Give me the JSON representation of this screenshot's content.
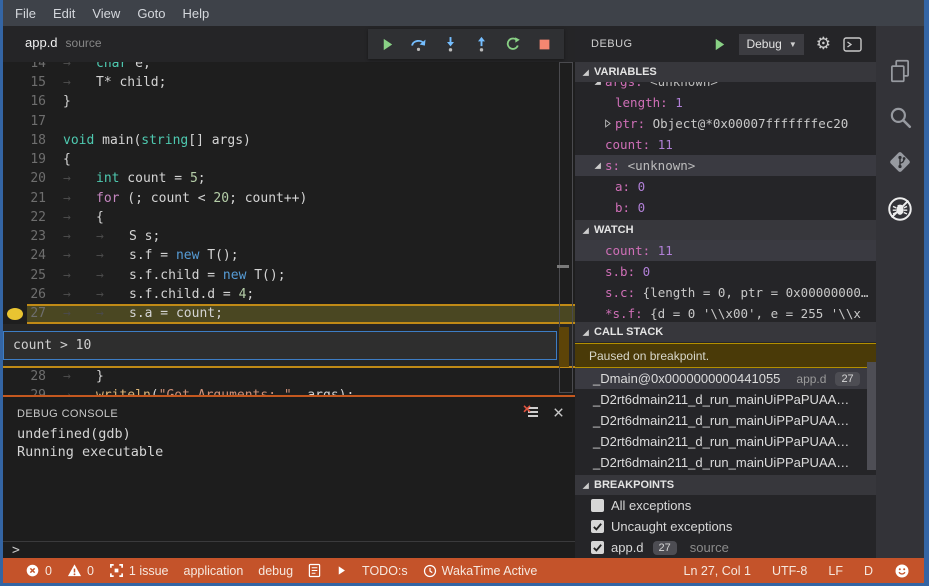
{
  "menu": {
    "items": [
      "File",
      "Edit",
      "View",
      "Goto",
      "Help"
    ]
  },
  "tab": {
    "name": "app.d",
    "hint": "source"
  },
  "toolbar": {
    "buttons": [
      {
        "icon": "continue"
      },
      {
        "icon": "step-over"
      },
      {
        "icon": "step-into"
      },
      {
        "icon": "step-out"
      },
      {
        "icon": "restart"
      },
      {
        "icon": "stop"
      }
    ]
  },
  "editor": {
    "breakpoint_line": 27,
    "current_line": 27,
    "condition": "count > 10",
    "lines": [
      {
        "num": 14,
        "tokens": [
          {
            "c": "tab",
            "v": "→"
          },
          {
            "c": "type",
            "v": "char"
          },
          {
            "v": " e;"
          }
        ]
      },
      {
        "num": 15,
        "tokens": [
          {
            "c": "tab",
            "v": "→"
          },
          {
            "v": "T* child;"
          }
        ]
      },
      {
        "num": 16,
        "tokens": [
          {
            "v": "}"
          }
        ]
      },
      {
        "num": 17,
        "tokens": []
      },
      {
        "num": 18,
        "tokens": [
          {
            "c": "type",
            "v": "void"
          },
          {
            "v": " main("
          },
          {
            "c": "type",
            "v": "string"
          },
          {
            "v": "[] args)"
          }
        ]
      },
      {
        "num": 19,
        "tokens": [
          {
            "v": "{"
          }
        ]
      },
      {
        "num": 20,
        "tokens": [
          {
            "c": "tab",
            "v": "→"
          },
          {
            "c": "type",
            "v": "int"
          },
          {
            "v": " count = "
          },
          {
            "c": "num",
            "v": "5"
          },
          {
            "v": ";"
          }
        ]
      },
      {
        "num": 21,
        "tokens": [
          {
            "c": "tab",
            "v": "→"
          },
          {
            "c": "ctrl",
            "v": "for"
          },
          {
            "v": " (; count < "
          },
          {
            "c": "num",
            "v": "20"
          },
          {
            "v": "; count++)"
          }
        ]
      },
      {
        "num": 22,
        "tokens": [
          {
            "c": "tab",
            "v": "→"
          },
          {
            "v": "{"
          }
        ]
      },
      {
        "num": 23,
        "tokens": [
          {
            "c": "tab",
            "v": "→"
          },
          {
            "c": "tab",
            "v": "→"
          },
          {
            "v": "S s;"
          }
        ]
      },
      {
        "num": 24,
        "tokens": [
          {
            "c": "tab",
            "v": "→"
          },
          {
            "c": "tab",
            "v": "→"
          },
          {
            "v": "s.f = "
          },
          {
            "c": "kwnew",
            "v": "new"
          },
          {
            "v": " T();"
          }
        ]
      },
      {
        "num": 25,
        "tokens": [
          {
            "c": "tab",
            "v": "→"
          },
          {
            "c": "tab",
            "v": "→"
          },
          {
            "v": "s.f.child = "
          },
          {
            "c": "kwnew",
            "v": "new"
          },
          {
            "v": " T();"
          }
        ]
      },
      {
        "num": 26,
        "tokens": [
          {
            "c": "tab",
            "v": "→"
          },
          {
            "c": "tab",
            "v": "→"
          },
          {
            "v": "s.f.child.d = "
          },
          {
            "c": "num",
            "v": "4"
          },
          {
            "v": ";"
          }
        ]
      },
      {
        "num": 27,
        "hl": true,
        "tokens": [
          {
            "c": "tab",
            "v": "→"
          },
          {
            "c": "tab",
            "v": "→"
          },
          {
            "v": "s.a = count;"
          }
        ]
      },
      {
        "num": 28,
        "tokens": [
          {
            "c": "tab",
            "v": "→"
          },
          {
            "v": "}"
          }
        ]
      },
      {
        "num": 29,
        "tokens": [
          {
            "c": "tab",
            "v": "→"
          },
          {
            "c": "fn",
            "v": "writeln"
          },
          {
            "v": "("
          },
          {
            "c": "str",
            "v": "\"Got Arguments: \""
          },
          {
            "v": ", args);"
          }
        ]
      }
    ]
  },
  "console": {
    "title": "DEBUG CONSOLE",
    "lines": [
      "undefined(gdb)",
      "Running executable"
    ],
    "prompt": ">"
  },
  "debug_panel": {
    "title": "DEBUG",
    "profile": "Debug",
    "sections": {
      "variables": "VARIABLES",
      "watch": "WATCH",
      "call_stack": "CALL STACK",
      "breakpoints": "BREAKPOINTS"
    },
    "variables": [
      {
        "twisty": "open",
        "name": "args",
        "value": "<unknown>",
        "vclass": "unk",
        "level": 0,
        "clipped": true
      },
      {
        "name": "length",
        "value": "1",
        "vclass": "num",
        "level": 1
      },
      {
        "twisty": "closed",
        "name": "ptr",
        "value": "Object@*0x00007fffffffec20",
        "vclass": "plain",
        "level": 1
      },
      {
        "name": "count",
        "value": "11",
        "vclass": "num",
        "level": 0
      },
      {
        "twisty": "open",
        "name": "s",
        "value": "<unknown>",
        "vclass": "unk",
        "level": 0,
        "selected": true
      },
      {
        "name": "a",
        "value": "0",
        "vclass": "num",
        "level": 1
      },
      {
        "name": "b",
        "value": "0",
        "vclass": "num",
        "level": 1
      }
    ],
    "watch": [
      {
        "name": "count",
        "value": "11",
        "vclass": "num",
        "selected": true
      },
      {
        "name": "s.b",
        "value": "0",
        "vclass": "num"
      },
      {
        "name": "s.c",
        "value": "{length = 0, ptr = 0x00000000…",
        "vclass": "plain"
      },
      {
        "name": "*s.f",
        "value": "{d = 0 '\\\\x00', e = 255 '\\\\x",
        "vclass": "plain"
      }
    ],
    "call_stack": {
      "message": "Paused on breakpoint.",
      "frames": [
        {
          "fn": "_Dmain@0x0000000000441055",
          "file": "app.d",
          "badge": "27",
          "selected": true
        },
        {
          "fn": "_D2rt6dmain211_d_run_mainUiPPaPUAA…"
        },
        {
          "fn": "_D2rt6dmain211_d_run_mainUiPPaPUAA…"
        },
        {
          "fn": "_D2rt6dmain211_d_run_mainUiPPaPUAA…"
        },
        {
          "fn": "_D2rt6dmain211_d_run_mainUiPPaPUAA…"
        }
      ]
    },
    "breakpoints": [
      {
        "checked": false,
        "label": "All exceptions"
      },
      {
        "checked": true,
        "label": "Uncaught exceptions"
      },
      {
        "checked": true,
        "label": "app.d",
        "badge": "27",
        "hint": "source"
      }
    ]
  },
  "activitybar": {
    "items": [
      {
        "icon": "files"
      },
      {
        "icon": "search"
      },
      {
        "icon": "git"
      },
      {
        "icon": "debug",
        "active": true
      }
    ]
  },
  "statusbar": {
    "left": [
      {
        "name": "errors",
        "icon": "error",
        "text": "0"
      },
      {
        "name": "warnings",
        "icon": "warning",
        "text": "0"
      },
      {
        "name": "issues",
        "icon": "frame",
        "text": "1 issue"
      },
      {
        "name": "task-application",
        "text": "application"
      },
      {
        "name": "task-debug",
        "text": "debug"
      },
      {
        "name": "document",
        "icon": "doc"
      },
      {
        "name": "run-task",
        "icon": "play-white"
      },
      {
        "name": "todos",
        "text": "TODO:s"
      },
      {
        "name": "wakatime",
        "icon": "clock",
        "text": "WakaTime Active"
      }
    ],
    "right": [
      {
        "name": "cursor-position",
        "text": "Ln 27, Col 1"
      },
      {
        "name": "encoding",
        "text": "UTF-8"
      },
      {
        "name": "eol",
        "text": "LF"
      },
      {
        "name": "language-mode",
        "text": "D"
      },
      {
        "name": "feedback",
        "icon": "smiley"
      }
    ]
  },
  "colors": {
    "status_bar": "#c4532a",
    "window_border": "#3465a4",
    "breakpoint": "#e9c431",
    "line_highlight": "#4a4722",
    "highlight_border": "#c08a16",
    "console_border": "#c4581f",
    "pause_banner_bg": "#4a3a08",
    "pause_banner_border": "#b38f00",
    "selection_bg": "#3a3a41",
    "var_name": "#cf6fb7",
    "var_number": "#b180d7"
  }
}
